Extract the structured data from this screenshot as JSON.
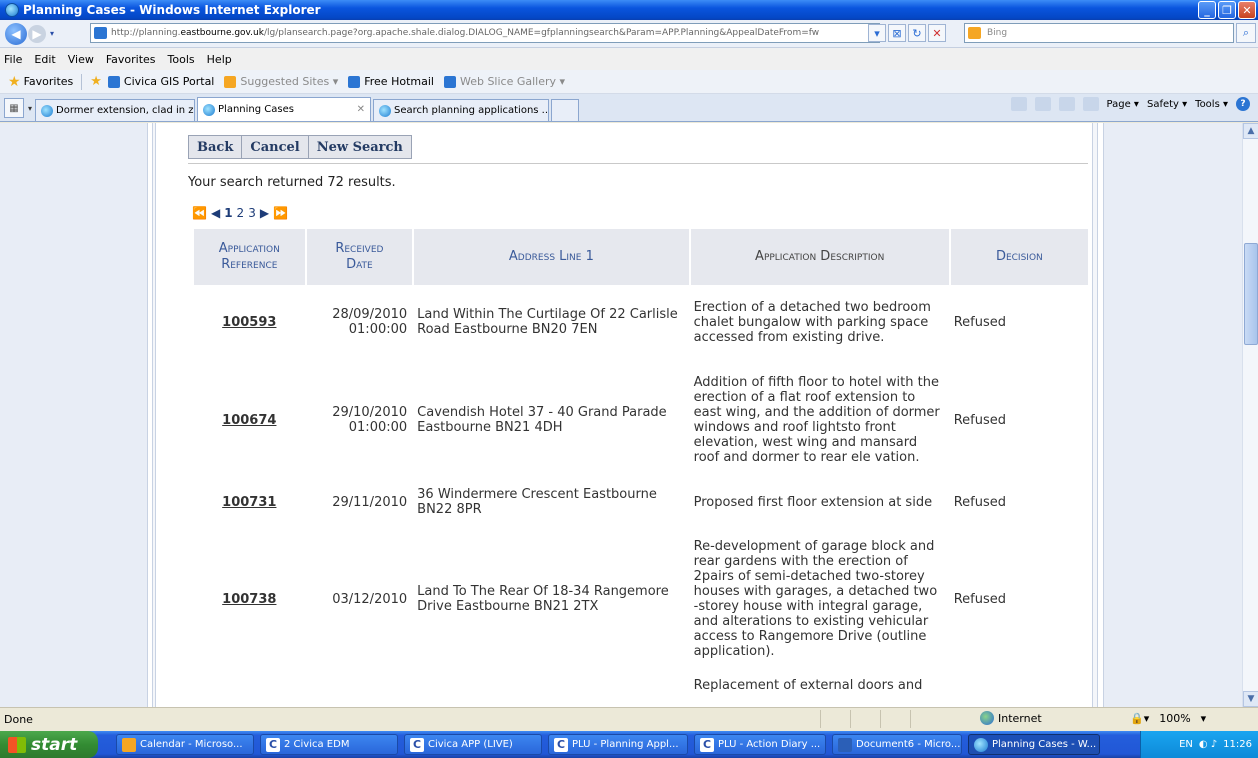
{
  "window": {
    "title": "Planning Cases - Windows Internet Explorer"
  },
  "address": {
    "url_prefix": "http://planning.",
    "url_domain": "eastbourne.gov.uk",
    "url_suffix": "/lg/plansearch.page?org.apache.shale.dialog.DIALOG_NAME=gfplanningsearch&Param=APP.Planning&AppealDateFrom=fw",
    "search_placeholder": "Bing"
  },
  "menu": [
    "File",
    "Edit",
    "View",
    "Favorites",
    "Tools",
    "Help"
  ],
  "favorites": {
    "label": "Favorites",
    "links": [
      {
        "label": "Civica GIS Portal",
        "grey": false
      },
      {
        "label": "Suggested Sites ▾",
        "grey": true
      },
      {
        "label": "Free Hotmail",
        "grey": false
      },
      {
        "label": "Web Slice Gallery ▾",
        "grey": true
      }
    ]
  },
  "tabs": [
    {
      "label": "Dormer extension, clad in zin...",
      "active": false
    },
    {
      "label": "Planning Cases",
      "active": true
    },
    {
      "label": "Search planning applications ...",
      "active": false
    }
  ],
  "commandbar": {
    "page": "Page ▾",
    "safety": "Safety ▾",
    "tools": "Tools ▾"
  },
  "page": {
    "buttons": {
      "back": "Back",
      "cancel": "Cancel",
      "new_search": "New Search"
    },
    "results_text": "Your search returned 72 results.",
    "pager": {
      "first": "⏪",
      "prev": "◀",
      "pages": [
        "1",
        "2",
        "3"
      ],
      "next": "▶",
      "last": "⏩"
    },
    "table": {
      "headers": {
        "ref_line1": "Application",
        "ref_line2": "Reference",
        "date_line1": "Received",
        "date_line2": "Date",
        "address": "Address Line 1",
        "description": "Application Description",
        "decision": "Decision"
      },
      "rows": [
        {
          "ref": "100593",
          "date1": "28/09/2010",
          "date2": "01:00:00",
          "address": "Land Within The Curtilage Of 22 Carlisle Road Eastbourne BN20 7EN",
          "description": "Erection of a detached two bedroom chalet bungalow with parking space accessed from existing drive.",
          "decision": "Refused"
        },
        {
          "ref": "100674",
          "date1": "29/10/2010",
          "date2": "01:00:00",
          "address": "Cavendish Hotel 37 - 40 Grand Parade Eastbourne BN21 4DH",
          "description": "Addition of fifth floor to hotel with the erection of a flat roof extension to east wing, and the addition of dormer windows and roof lightsto front elevation, west wing and mansard roof and dormer to rear ele vation.",
          "decision": "Refused"
        },
        {
          "ref": "100731",
          "date1": "29/11/2010",
          "date2": "",
          "address": "36 Windermere Crescent Eastbourne BN22 8PR",
          "description": "Proposed first floor extension at side",
          "decision": "Refused"
        },
        {
          "ref": "100738",
          "date1": "03/12/2010",
          "date2": "",
          "address": "Land To The Rear Of 18-34 Rangemore Drive Eastbourne BN21 2TX",
          "description": "Re-development of garage block and rear gardens with the erection of 2pairs of semi-detached two-storey houses with garages, a detached two -storey house with integral garage, and alterations to existing vehicular access to Rangemore Drive (outline application).",
          "decision": "Refused"
        },
        {
          "ref": "",
          "date1": "",
          "date2": "",
          "address": "",
          "description": "Replacement of external doors and",
          "decision": ""
        }
      ]
    }
  },
  "status": {
    "text": "Done",
    "zone": "Internet",
    "zoom": "100%"
  },
  "taskbar": {
    "start": "start",
    "items": [
      {
        "label": "Calendar - Microso...",
        "icon": "O",
        "active": false
      },
      {
        "label": "2 Civica EDM",
        "icon": "C",
        "active": false
      },
      {
        "label": "Civica APP (LIVE)",
        "icon": "C",
        "active": false
      },
      {
        "label": "PLU - Planning Appl...",
        "icon": "C",
        "active": false
      },
      {
        "label": "PLU - Action Diary ...",
        "icon": "C",
        "active": false
      },
      {
        "label": "Document6 - Micro...",
        "icon": "W",
        "active": false
      },
      {
        "label": "Planning Cases - W...",
        "icon": "ie",
        "active": true
      }
    ],
    "lang": "EN",
    "clock": "11:26"
  },
  "colors": {
    "titlebar": "#0a55de",
    "header_text": "#3a5a9a",
    "taskbar": "#245edc",
    "start": "#338c33"
  }
}
